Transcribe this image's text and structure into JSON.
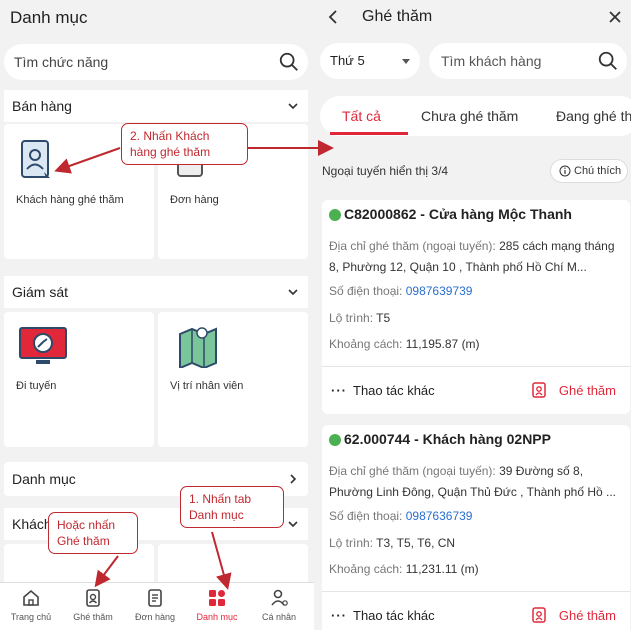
{
  "left": {
    "title": "Danh mục",
    "search_placeholder": "Tìm chức năng",
    "sections": {
      "sales": {
        "label": "Bán hàng"
      },
      "monitor": {
        "label": "Giám sát"
      },
      "catalog": {
        "label": "Danh mục"
      },
      "customer": {
        "label": "Khách"
      }
    },
    "tiles": {
      "visit_customer": {
        "label": "Khách hàng ghé thăm",
        "icon": "customer-visit-icon"
      },
      "orders": {
        "label": "Đơn hàng",
        "icon": "order-icon"
      },
      "route": {
        "label": "Đi tuyến",
        "icon": "route-monitor-icon"
      },
      "staff_location": {
        "label": "Vị trí nhân viên",
        "icon": "map-pin-icon"
      }
    },
    "nav": [
      {
        "label": "Trang chủ",
        "icon": "home-icon"
      },
      {
        "label": "Ghé thăm",
        "icon": "visit-icon"
      },
      {
        "label": "Đơn hàng",
        "icon": "order-icon"
      },
      {
        "label": "Danh mục",
        "icon": "grid-icon",
        "active": true
      },
      {
        "label": "Cá nhân",
        "icon": "user-icon"
      }
    ]
  },
  "callouts": {
    "step2": "2. Nhấn Khách hàng ghé thăm",
    "alt": "Hoặc nhấn Ghé thăm",
    "step1": "1. Nhấn tab Danh mục"
  },
  "right": {
    "title": "Ghé thăm",
    "day_filter": "Thứ 5",
    "search_placeholder": "Tìm khách hàng",
    "tabs": [
      "Tất cả",
      "Chưa ghé thăm",
      "Đang ghé th"
    ],
    "route_info": "Ngoại tuyến hiển thị 3/4",
    "note_label": "Chú thích",
    "customers": [
      {
        "name": "C82000862 - Cửa hàng Mộc Thanh",
        "addr_key": "Địa chỉ ghé thăm (ngoại tuyến):",
        "addr_val": "285 cách mạng tháng 8, Phường 12, Quận 10 , Thành phố Hồ Chí M...",
        "phone_key": "Số điện thoại:",
        "phone_val": "0987639739",
        "route_key": "Lộ trình:",
        "route_val": "T5",
        "dist_key": "Khoảng cách:",
        "dist_val": "11,195.87 (m)",
        "more": "Thao tác khác",
        "visit": "Ghé thăm"
      },
      {
        "name": "62.000744 - Khách hàng 02NPP",
        "addr_key": "Địa chỉ ghé thăm (ngoại tuyến):",
        "addr_val": "39 Đường số 8, Phường Linh Đông, Quận Thủ Đức , Thành phố Hồ ...",
        "phone_key": "Số điện thoại:",
        "phone_val": "0987636739",
        "route_key": "Lộ trình:",
        "route_val": "T3, T5, T6, CN",
        "dist_key": "Khoảng cách:",
        "dist_val": "11,231.11 (m)",
        "more": "Thao tác khác",
        "visit": "Ghé thăm"
      }
    ]
  },
  "colors": {
    "accent": "#e0283a",
    "callout": "#c0282f",
    "link": "#2a6fd0",
    "online": "#4caf50"
  }
}
